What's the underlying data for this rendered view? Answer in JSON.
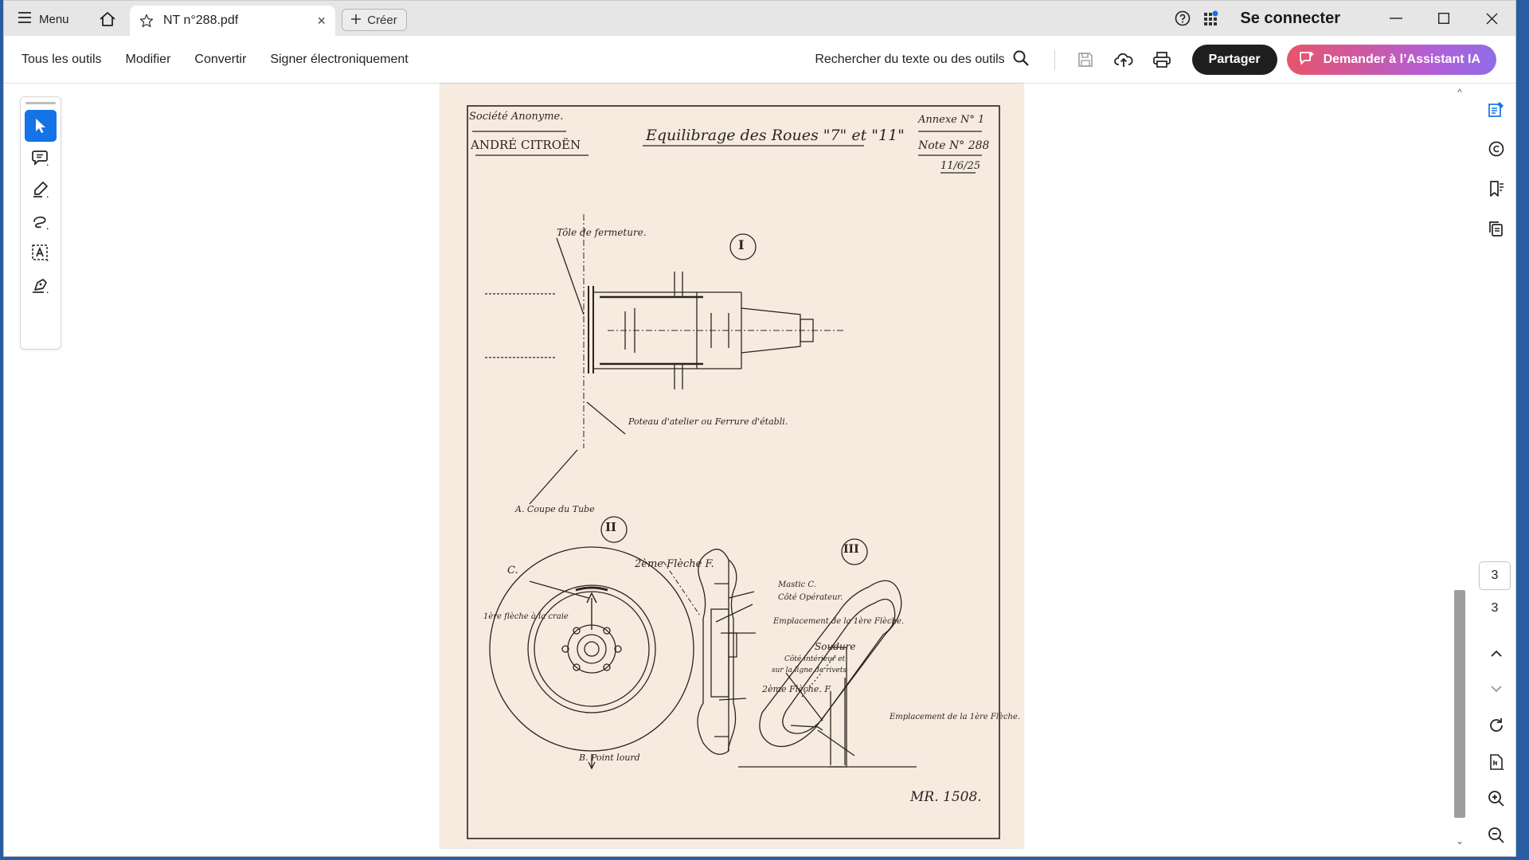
{
  "titlebar": {
    "menu_label": "Menu",
    "tab_title": "NT n°288.pdf",
    "tab_close": "×",
    "create_label": "Créer",
    "signin_label": "Se connecter"
  },
  "toolbar": {
    "menu": [
      "Tous les outils",
      "Modifier",
      "Convertir",
      "Signer électroniquement"
    ],
    "search_label": "Rechercher du texte ou des outils",
    "share_label": "Partager",
    "ai_label": "Demander à l’Assistant IA"
  },
  "document": {
    "header_left_1": "Société Anonyme.",
    "header_left_2": "ANDRÉ CITROËN",
    "title": "Equilibrage des Roues \"7\" et \"11\"",
    "annexe": "Annexe N° 1",
    "note": "Note N° 288",
    "date": "11/6/25",
    "fig1": "I",
    "fig2": "II",
    "fig3": "III",
    "tole": "Tôle de fermeture.",
    "coupe": "A. Coupe du Tube",
    "poteau": "Poteau d'atelier ou Ferrure d'établi.",
    "c_label": "C.",
    "fleche2_top": "2ème Flèche F.",
    "fleche1": "1ère flèche à la craie",
    "mastic": "Mastic C.",
    "cote_op": "Côté Opérateur.",
    "empl1": "Emplacement de la 1ère Flèche.",
    "soudure": "Soudure",
    "cote_int_1": "Côté intérieur et",
    "cote_int_2": "sur la ligne de rivets",
    "fleche2_mid": "2ème Flèche. F.",
    "empl2": "Emplacement de la 1ère Flèche.",
    "point_lourd": "B. Point lourd",
    "ref": "MR. 1508."
  },
  "navigation": {
    "current_page": "3",
    "total_pages": "3"
  },
  "colors": {
    "accent_blue": "#1473e6",
    "paper": "#f7ebe0",
    "ink": "#2a2420"
  }
}
